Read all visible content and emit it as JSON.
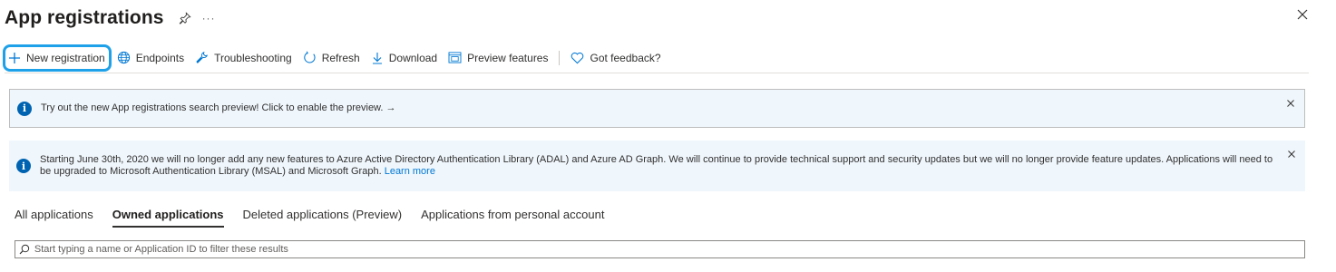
{
  "header": {
    "title": "App registrations",
    "more_label": "···"
  },
  "toolbar": {
    "items": [
      {
        "label": "New registration",
        "icon": "plus-icon"
      },
      {
        "label": "Endpoints",
        "icon": "globe-icon"
      },
      {
        "label": "Troubleshooting",
        "icon": "wrench-icon"
      },
      {
        "label": "Refresh",
        "icon": "refresh-icon"
      },
      {
        "label": "Download",
        "icon": "download-icon"
      },
      {
        "label": "Preview features",
        "icon": "preview-icon"
      },
      {
        "label": "Got feedback?",
        "icon": "heart-icon"
      }
    ]
  },
  "banners": {
    "search_preview": "Try out the new App registrations search preview! Click to enable the preview. →",
    "adal_notice": "Starting June 30th, 2020 we will no longer add any new features to Azure Active Directory Authentication Library (ADAL) and Azure AD Graph. We will continue to provide technical support and security updates but we will no longer provide feature updates. Applications will need to be upgraded to Microsoft Authentication Library (MSAL) and Microsoft Graph.",
    "learn_more": "Learn more"
  },
  "tabs": [
    {
      "label": "All applications",
      "active": false
    },
    {
      "label": "Owned applications",
      "active": true
    },
    {
      "label": "Deleted applications (Preview)",
      "active": false
    },
    {
      "label": "Applications from personal account",
      "active": false
    }
  ],
  "search": {
    "placeholder": "Start typing a name or Application ID to filter these results"
  },
  "colors": {
    "accent": "#0078d4",
    "highlight_border": "#1ea1e8",
    "banner_bg": "#eff6fc",
    "info_icon": "#0063b1"
  }
}
